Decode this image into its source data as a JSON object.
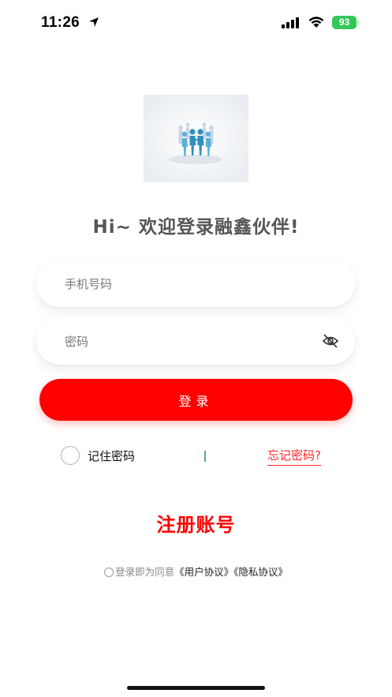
{
  "status_bar": {
    "time": "11:26",
    "battery": "93"
  },
  "logo_icon": "people-holding-hands-circle",
  "welcome_text": "Hi~ 欢迎登录融鑫伙伴!",
  "form": {
    "phone_placeholder": "手机号码",
    "password_placeholder": "密码",
    "login_label": "登录",
    "remember_label": "记住密码",
    "forgot_label": "忘记密码?"
  },
  "register_label": "注册账号",
  "agreement": {
    "prefix": "登录即为同意",
    "user_agreement": "《用户协议》",
    "privacy_agreement": "《隐私协议》"
  },
  "colors": {
    "primary": "#ff0000",
    "battery": "#33c759",
    "divider": "#5aa99a"
  }
}
